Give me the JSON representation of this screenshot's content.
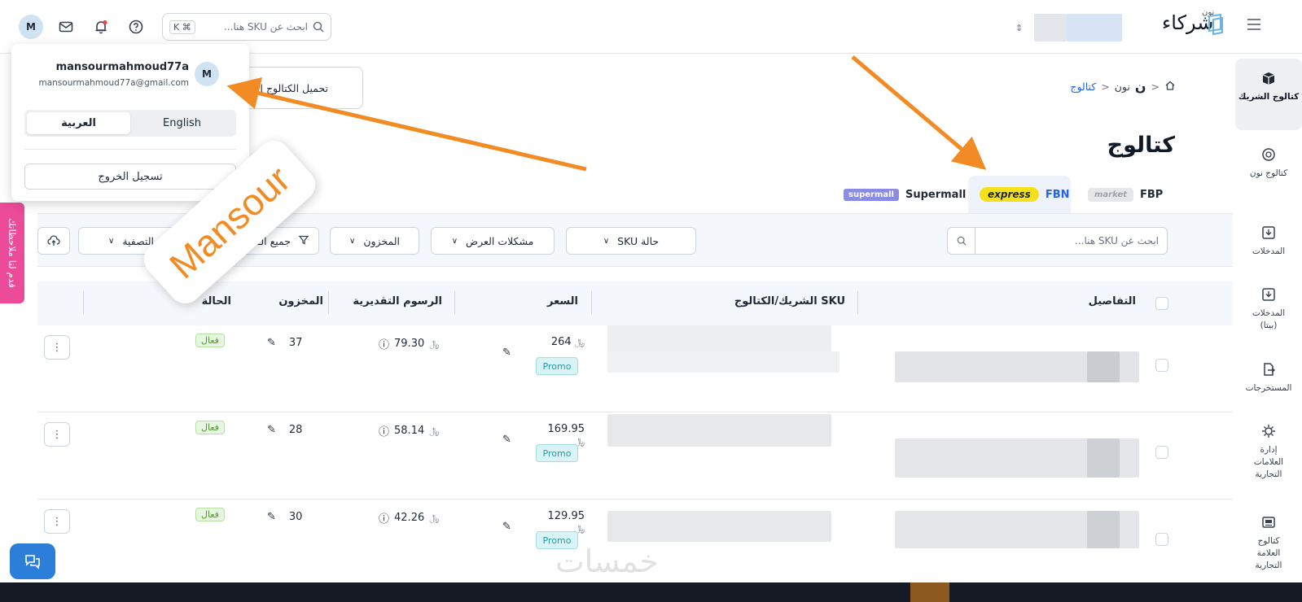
{
  "topbar": {
    "avatar_letter": "M",
    "search_placeholder": "ابحث عن SKU هنا...",
    "shortcut_key": "K",
    "shortcut_cmd": "⌘",
    "logo_small": "نون",
    "logo_text": "شركاء"
  },
  "account_menu": {
    "avatar_letter": "M",
    "username": "mansourmahmoud77a",
    "email": "mansourmahmoud77a@gmail.com",
    "lang_english": "English",
    "lang_arabic": "العربية",
    "logout": "تسجيل الخروج"
  },
  "sidebar": {
    "items": [
      {
        "label": "كتالوج الشريك"
      },
      {
        "label": "كتالوج نون"
      },
      {
        "label": "المدخلات"
      },
      {
        "label": "المدخلات (بيتا)"
      },
      {
        "label": "المستخرجات"
      },
      {
        "label": "إدارة العلامات التجارية"
      },
      {
        "label": "كتالوج العلامة التجارية"
      }
    ]
  },
  "breadcrumb": {
    "home_icon": "home-icon",
    "noon": "نون",
    "catalog": "كتالوج"
  },
  "page": {
    "title": "كتالوج",
    "download_button": "تحميل الكتالوج القديم"
  },
  "tabs": [
    {
      "badge": "market",
      "label": "FBP"
    },
    {
      "badge": "express",
      "label": "FBN"
    },
    {
      "badge": "supermall",
      "label": "Supermall"
    }
  ],
  "filters": {
    "search_placeholder": "ابحث عن SKU هنا...",
    "sku_status": "حالة SKU",
    "display_issues": "مشكلات العرض",
    "stock": "المخزون",
    "all_filters": "جميع الـ",
    "sort": "التصفية"
  },
  "table": {
    "headers": {
      "details": "التفاصيل",
      "sku": "SKU الشريك/الكتالوج",
      "price": "السعر",
      "fees": "الرسوم التقديرية",
      "stock": "المخزون",
      "status": "الحالة"
    },
    "currency_symbol": "﷼",
    "rows": [
      {
        "price": "264",
        "promo": "Promo",
        "fee": "79.30",
        "stock": "37",
        "status": "فعال"
      },
      {
        "price": "169.95",
        "promo": "Promo",
        "fee": "58.14",
        "stock": "28",
        "status": "فعال"
      },
      {
        "price": "129.95",
        "promo": "Promo",
        "fee": "42.26",
        "stock": "30",
        "status": "فعال"
      }
    ]
  },
  "feedback_tab": "قدم لنا ملاحظاتك",
  "annotation_label": "Mansour",
  "watermark": "خمسات",
  "colors": {
    "accent_blue": "#2563eb",
    "arrow_orange": "#f28b24",
    "feedback_pink": "#ec4b9a",
    "status_green": "#4d9b2f",
    "promo_teal": "#2b9aa8"
  }
}
